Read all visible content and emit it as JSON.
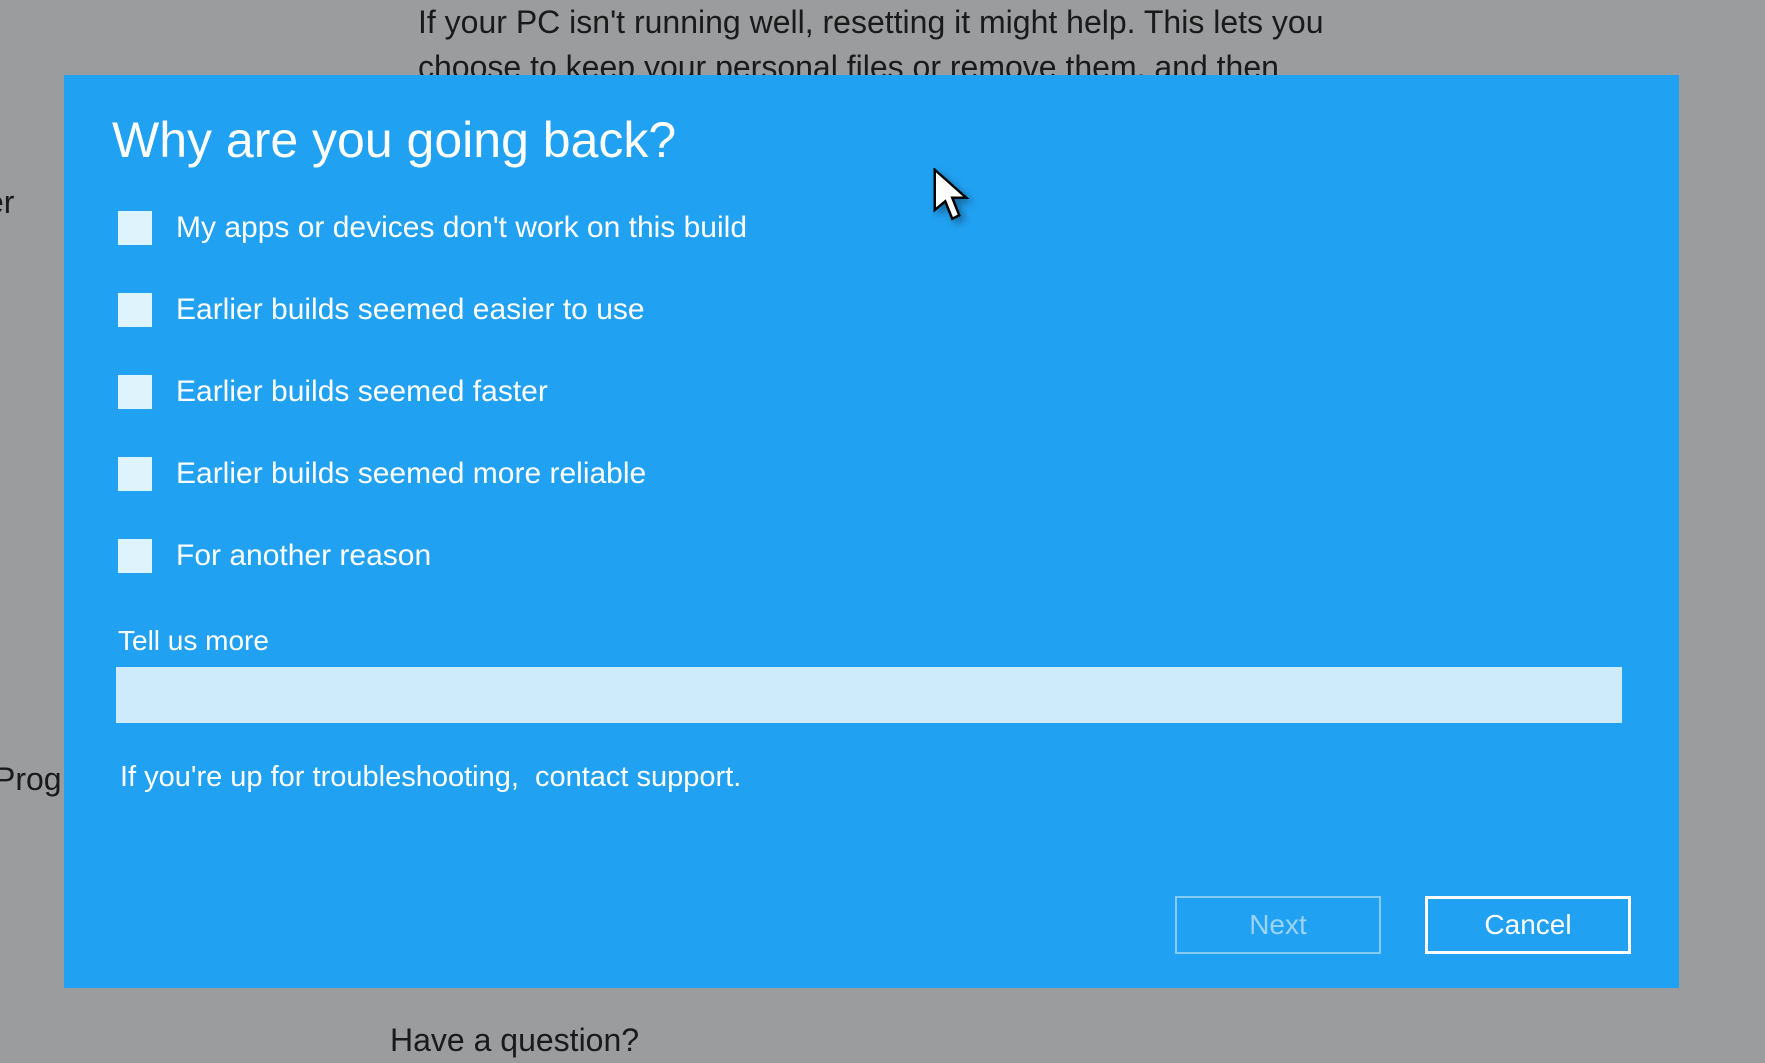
{
  "background": {
    "top_text": "If your PC isn't running well, resetting it might help. This lets you choose to keep your personal files or remove them, and then",
    "left_fragment_1": "er",
    "left_fragment_2": "Prog",
    "bottom_text": "Have a question?"
  },
  "dialog": {
    "title": "Why are you going back?",
    "options": [
      {
        "label": "My apps or devices don't work on this build"
      },
      {
        "label": "Earlier builds seemed easier to use"
      },
      {
        "label": "Earlier builds seemed faster"
      },
      {
        "label": "Earlier builds seemed more reliable"
      },
      {
        "label": "For another reason"
      }
    ],
    "tell_us_label": "Tell us more",
    "tell_us_value": "",
    "support_text": "If you're up for troubleshooting,",
    "support_link": "contact support.",
    "next_label": "Next",
    "cancel_label": "Cancel"
  }
}
